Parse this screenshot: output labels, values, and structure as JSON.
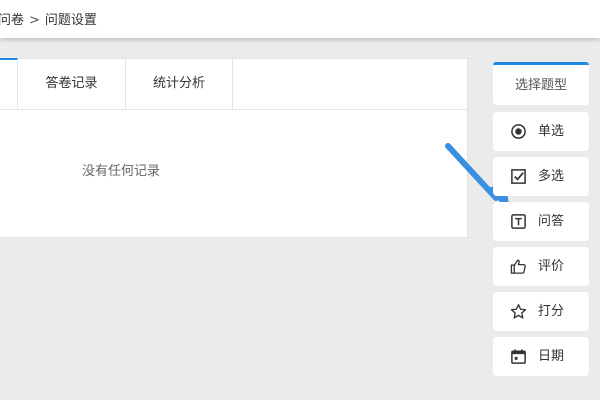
{
  "breadcrumb": {
    "parent": "问卷",
    "separator": ">",
    "current": "问题设置"
  },
  "tabs": [
    {
      "label": "答卷记录"
    },
    {
      "label": "统计分析"
    }
  ],
  "records": {
    "empty_text": "没有任何记录"
  },
  "question_types": {
    "header": "选择题型",
    "items": [
      {
        "label": "单选",
        "icon": "radio-icon"
      },
      {
        "label": "多选",
        "icon": "checkbox-icon"
      },
      {
        "label": "问答",
        "icon": "text-icon"
      },
      {
        "label": "评价",
        "icon": "thumbs-up-icon"
      },
      {
        "label": "打分",
        "icon": "star-icon"
      },
      {
        "label": "日期",
        "icon": "calendar-icon"
      }
    ]
  },
  "colors": {
    "accent": "#1e88e5",
    "arrow": "#3a8fe0",
    "background": "#ebebeb"
  }
}
